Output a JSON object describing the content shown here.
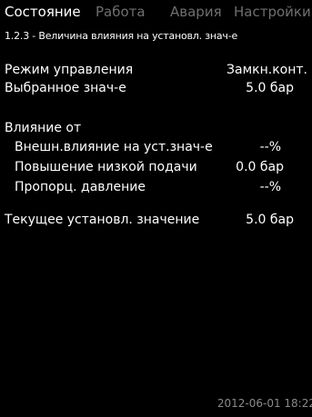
{
  "tabs": [
    {
      "label": "Состояние",
      "active": true
    },
    {
      "label": "Работа",
      "active": false
    },
    {
      "label": "Авария",
      "active": false
    },
    {
      "label": "Настройки",
      "active": false
    }
  ],
  "breadcrumb": "1.2.3 - Величина влияния на установл. знач-е",
  "rows": {
    "control_mode": {
      "label": "Режим управления",
      "value": "Замкн.конт."
    },
    "selected_value": {
      "label": "Выбранное знач-е",
      "value": "5.0 бар"
    },
    "influence_header": {
      "label": "Влияние от"
    },
    "ext_influence": {
      "label": "Внешн.влияние на уст.знач-е",
      "value": "--%"
    },
    "low_flow_boost": {
      "label": "Повышение низкой подачи",
      "value": "0.0 бар"
    },
    "prop_pressure": {
      "label": "Пропорц. давление",
      "value": "--%"
    },
    "current_setpoint": {
      "label": "Текущее установл. значение",
      "value": "5.0 бар"
    }
  },
  "footer": {
    "timestamp": "2012-06-01 18:22"
  }
}
